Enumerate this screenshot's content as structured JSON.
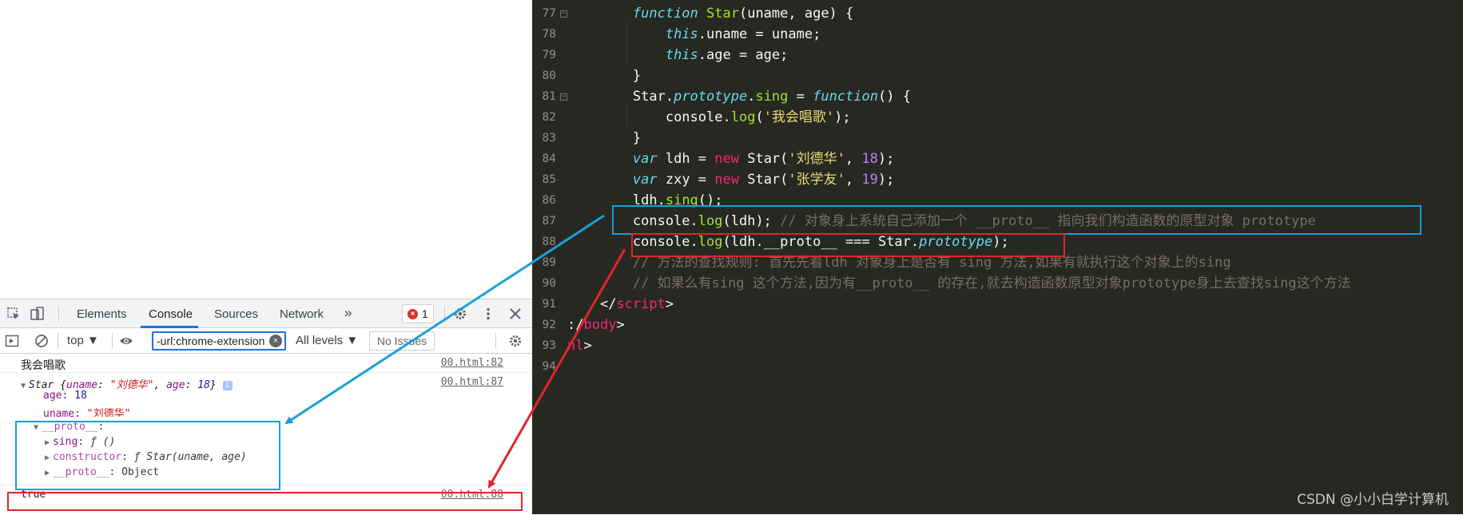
{
  "devtools": {
    "tabs": [
      "Elements",
      "Console",
      "Sources",
      "Network"
    ],
    "active_tab": "Console",
    "more_tabs": "»",
    "error_count": "1",
    "context": "top ▼",
    "filter_value": "-url:chrome-extension",
    "levels": "All levels ▼",
    "issues": "No Issues"
  },
  "console": {
    "line1": {
      "text": "我会唱歌",
      "src": "00.html:82"
    },
    "line2": {
      "class_name": "Star",
      "brace_open": " {",
      "k_uname": "uname",
      "v_uname": "\"刘德华\"",
      "comma": ", ",
      "k_age": "age",
      "colon": ": ",
      "v_age": "18",
      "brace_close": "}",
      "info": "i",
      "src": "00.html:87"
    },
    "age": {
      "key": "age",
      "val": "18"
    },
    "uname": {
      "key": "uname",
      "val": "\"刘德华\""
    },
    "proto": {
      "key": "__proto__",
      "suffix": ":"
    },
    "sing": {
      "key": "sing",
      "val": "ƒ ()"
    },
    "constructor": {
      "key": "constructor",
      "val": "ƒ Star(uname, age)"
    },
    "proto2": {
      "key": "__proto__",
      "val": ": Object"
    },
    "result": {
      "text": "true",
      "src": "00.html:88"
    }
  },
  "editor": {
    "lines": [
      {
        "n": "77",
        "fold": "−"
      },
      {
        "n": "78"
      },
      {
        "n": "79"
      },
      {
        "n": "80"
      },
      {
        "n": "81",
        "fold": "−"
      },
      {
        "n": "82"
      },
      {
        "n": "83"
      },
      {
        "n": "84"
      },
      {
        "n": "85"
      },
      {
        "n": "86"
      },
      {
        "n": "87"
      },
      {
        "n": "88"
      },
      {
        "n": "89"
      },
      {
        "n": "90"
      },
      {
        "n": "91"
      },
      {
        "n": "92"
      },
      {
        "n": "93"
      },
      {
        "n": "94"
      }
    ],
    "code": {
      "l77": {
        "kw": "function",
        "fn": " Star",
        "rest": "(uname, age) {"
      },
      "l78": {
        "kw": "this",
        "rest": ".uname = uname;"
      },
      "l79": {
        "kw": "this",
        "rest": ".age = age;"
      },
      "l80": {
        "rest": "}"
      },
      "l81": {
        "a": "Star.",
        "b": "prototype",
        "c": ".",
        "d": "sing",
        "e": " = ",
        "f": "function",
        "g": "() {"
      },
      "l82": {
        "a": "console.",
        "b": "log",
        "c": "(",
        "d": "'我会唱歌'",
        "e": ");"
      },
      "l83": {
        "rest": "}"
      },
      "l84": {
        "a": "var",
        "b": " ldh = ",
        "c": "new",
        "d": " Star(",
        "e": "'刘德华'",
        "f": ", ",
        "g": "18",
        "h": ");"
      },
      "l85": {
        "a": "var",
        "b": " zxy = ",
        "c": "new",
        "d": " Star(",
        "e": "'张学友'",
        "f": ", ",
        "g": "19",
        "h": ");"
      },
      "l86": {
        "a": "ldh.",
        "b": "sing",
        "c": "();"
      },
      "l87": {
        "a": "console.",
        "b": "log",
        "c": "(ldh); ",
        "d": "// 对象身上系统自己添加一个 __proto__ 指向我们构造函数的原型对象 prototype"
      },
      "l88": {
        "a": "console.",
        "b": "log",
        "c": "(ldh.__proto__ === Star.",
        "d": "prototype",
        "e": ");"
      },
      "l89": {
        "cm": "// 方法的查找规则: 首先先看ldh 对象身上是否有 sing 方法,如果有就执行这个对象上的sing"
      },
      "l90": {
        "cm": "// 如果么有sing 这个方法,因为有__proto__ 的存在,就去构造函数原型对象prototype身上去查找sing这个方法"
      },
      "l91": {
        "a": "</",
        "b": "script",
        "c": ">"
      },
      "l92": {
        "a": ":/",
        "b": "body",
        "c": ">"
      },
      "l93": {
        "a": "nl",
        "b": ">"
      }
    }
  },
  "watermark": "CSDN @小小白学计算机",
  "colors": {
    "blue_annotation": "#1a9fd8",
    "red_annotation": "#e0262b",
    "editor_bg": "#272822"
  }
}
